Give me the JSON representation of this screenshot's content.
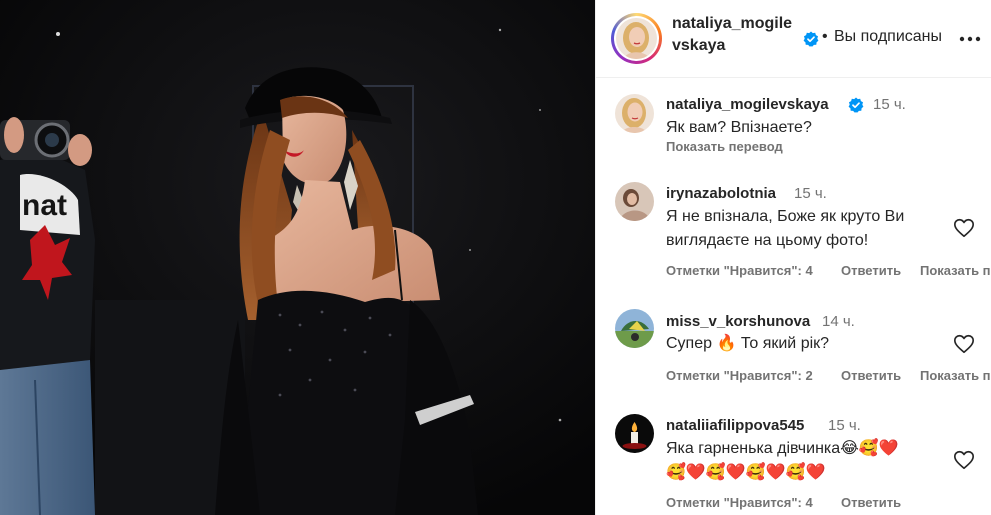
{
  "post": {
    "username_line1": "nataliya_mogile",
    "username_line2": "vskaya",
    "separator": "•",
    "follow_status": "Вы подписаны",
    "more_icon": "more-horizontal-icon"
  },
  "caption": {
    "username": "nataliya_mogilevskaya",
    "time": "15 ч.",
    "text": "Як вам? Впізнаете?",
    "translate": "Показать перевод"
  },
  "comments": [
    {
      "username": "irynazabolotnia",
      "time": "15 ч.",
      "text": "Я не впізнала, Боже як круто Ви виглядаєте на цьому фото!",
      "likes": "Отметки \"Нравится\": 4",
      "reply": "Ответить",
      "show": "Показать п"
    },
    {
      "username": "miss_v_korshunova",
      "time": "14 ч.",
      "text_before": "Супер ",
      "emoji": "🔥",
      "text_after": " То який рік?",
      "likes": "Отметки \"Нравится\": 2",
      "reply": "Ответить",
      "show": "Показать п"
    },
    {
      "username": "nataliiafilippova545",
      "time": "15 ч.",
      "text": "Яка гарненька дівчинка",
      "emoji_line1": [
        "😂",
        "🥰",
        "❤️"
      ],
      "emoji_line2": [
        "🥰",
        "❤️",
        "🥰",
        "❤️",
        "🥰",
        "❤️",
        "🥰",
        "❤️"
      ],
      "likes": "Отметки \"Нравится\": 4",
      "reply": "Ответить"
    }
  ],
  "colors": {
    "verified_blue": "#0095f6",
    "secondary_text": "#737373",
    "primary_text": "#262626"
  }
}
